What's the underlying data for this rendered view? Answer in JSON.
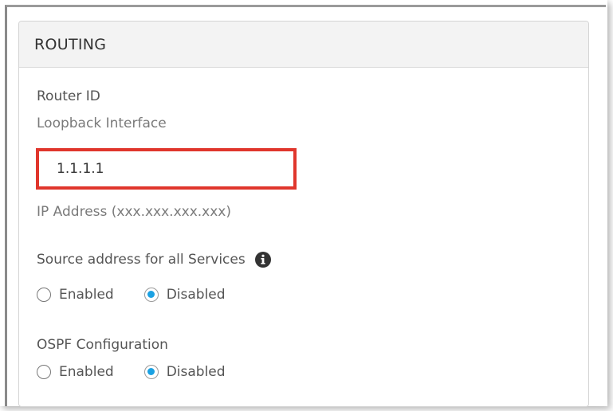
{
  "routing": {
    "title": "ROUTING",
    "router_id": {
      "label": "Router ID",
      "sublabel": "Loopback Interface",
      "value": "1.1.1.1",
      "hint": "IP Address (xxx.xxx.xxx.xxx)"
    },
    "source_address": {
      "label": "Source address for all Services",
      "options": [
        {
          "label": "Enabled",
          "selected": false
        },
        {
          "label": "Disabled",
          "selected": true
        }
      ]
    },
    "ospf": {
      "label": "OSPF Configuration",
      "options": [
        {
          "label": "Enabled",
          "selected": false
        },
        {
          "label": "Disabled",
          "selected": true
        }
      ]
    }
  },
  "colors": {
    "highlight_border": "#e0362c",
    "radio_selected": "#1ba1e2",
    "header_bg": "#f3f3f3"
  },
  "icons": {
    "info": "info-icon"
  }
}
